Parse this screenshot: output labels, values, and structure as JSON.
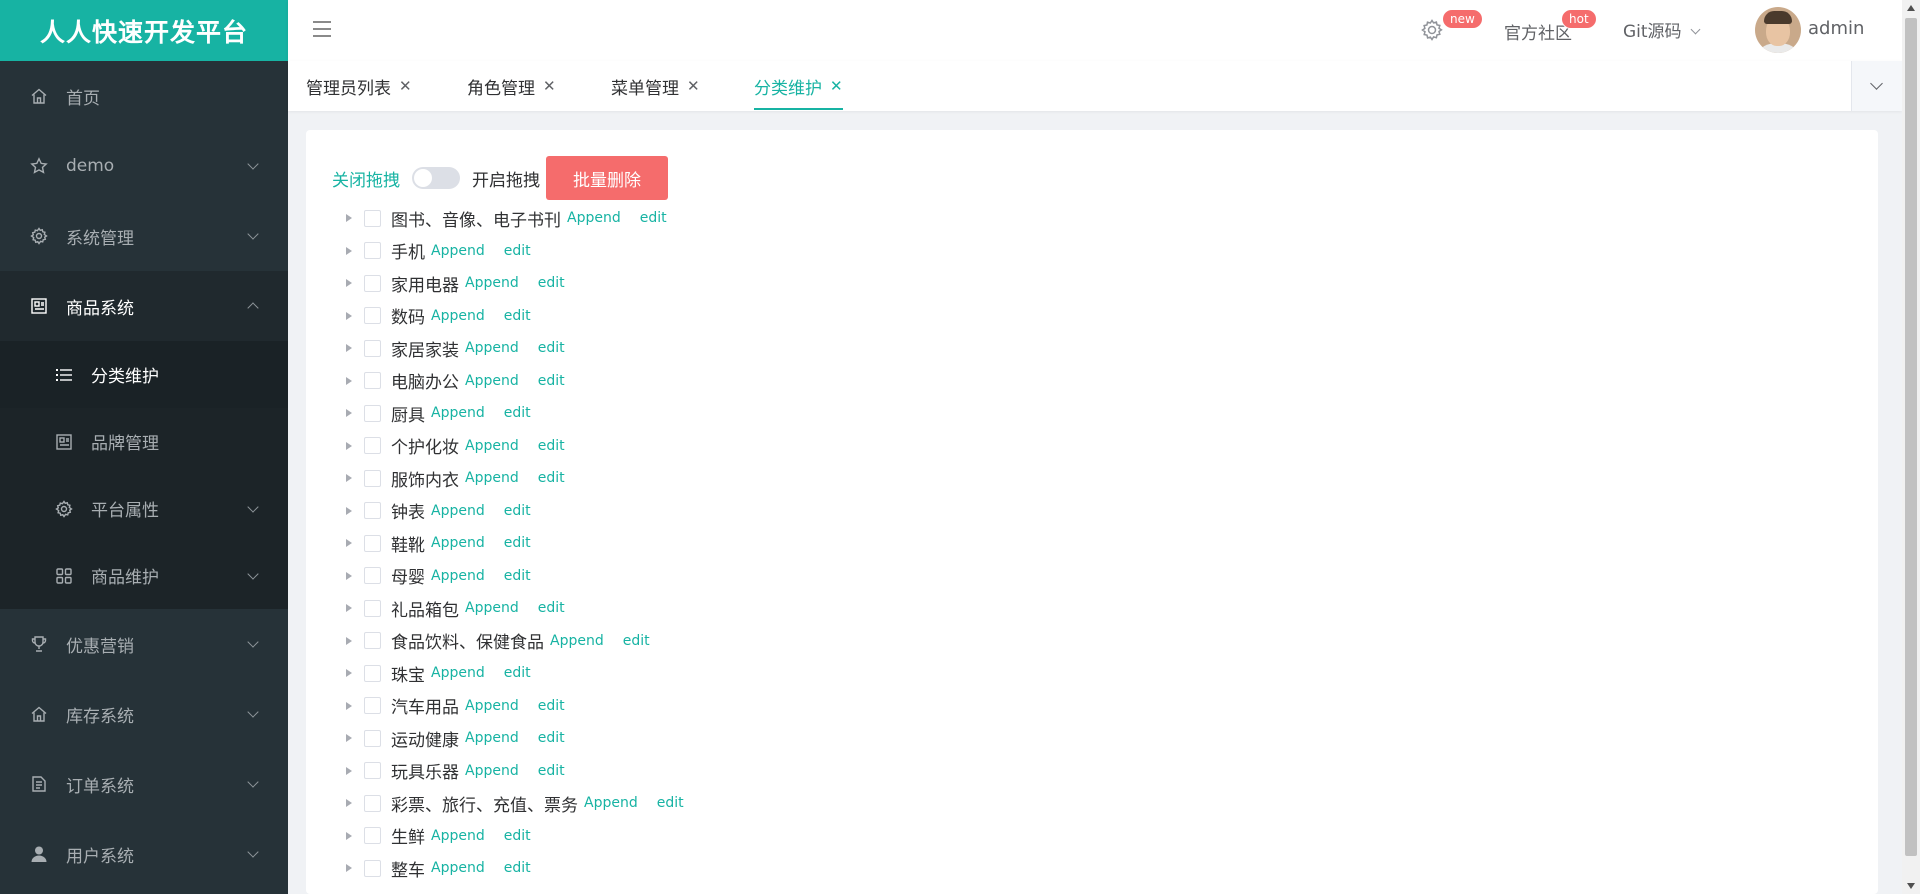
{
  "brand": "人人快速开发平台",
  "header": {
    "badge_new": "new",
    "community": "官方社区",
    "badge_hot": "hot",
    "git": "Git源码",
    "username": "admin"
  },
  "sidebar": {
    "items": [
      {
        "label": "首页",
        "icon": "home-icon"
      },
      {
        "label": "demo",
        "icon": "star-icon"
      },
      {
        "label": "系统管理",
        "icon": "gear-icon"
      },
      {
        "label": "商品系统",
        "icon": "list-box-icon"
      },
      {
        "label": "分类维护",
        "icon": "list-icon"
      },
      {
        "label": "品牌管理",
        "icon": "image-icon"
      },
      {
        "label": "平台属性",
        "icon": "gear-icon"
      },
      {
        "label": "商品维护",
        "icon": "grid-icon"
      },
      {
        "label": "优惠营销",
        "icon": "trophy-icon"
      },
      {
        "label": "库存系统",
        "icon": "home-icon"
      },
      {
        "label": "订单系统",
        "icon": "document-icon"
      },
      {
        "label": "用户系统",
        "icon": "user-icon"
      }
    ]
  },
  "tabs": [
    {
      "label": "管理员列表"
    },
    {
      "label": "角色管理"
    },
    {
      "label": "菜单管理"
    },
    {
      "label": "分类维护"
    }
  ],
  "toolbar": {
    "drag_off": "关闭拖拽",
    "drag_on": "开启拖拽",
    "batch_delete": "批量删除"
  },
  "tree": {
    "append_label": "Append",
    "edit_label": "edit",
    "nodes": [
      "图书、音像、电子书刊",
      "手机",
      "家用电器",
      "数码",
      "家居家装",
      "电脑办公",
      "厨具",
      "个护化妆",
      "服饰内衣",
      "钟表",
      "鞋靴",
      "母婴",
      "礼品箱包",
      "食品饮料、保健食品",
      "珠宝",
      "汽车用品",
      "运动健康",
      "玩具乐器",
      "彩票、旅行、充值、票务",
      "生鲜",
      "整车"
    ]
  },
  "colors": {
    "accent": "#17b3a3",
    "danger": "#f56c6c",
    "sidebar_bg": "#263238"
  }
}
